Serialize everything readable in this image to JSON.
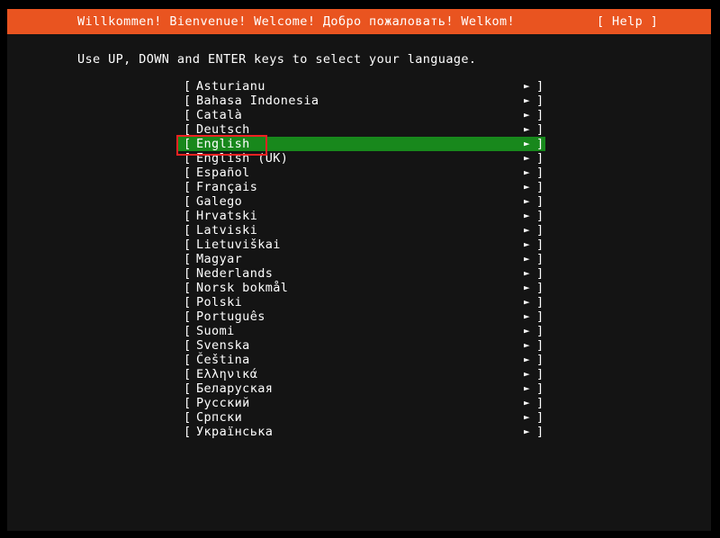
{
  "window": {
    "bezel_color": "#000000",
    "terminal_bg": "#141414"
  },
  "banner": {
    "title": "Willkommen! Bienvenue! Welcome! Добро пожаловать! Welkom!",
    "help_label": "[ Help ]",
    "bg_color": "#e95420",
    "text_color": "#ffffff"
  },
  "instruction": {
    "text": "Use UP, DOWN and ENTER keys to select your language."
  },
  "language_menu": {
    "selected_index": 4,
    "highlight_color": "#18881c",
    "bracket_open": "[",
    "bracket_close": "]",
    "submenu_arrow": "►",
    "items": [
      {
        "label": "Asturianu"
      },
      {
        "label": "Bahasa Indonesia"
      },
      {
        "label": "Català"
      },
      {
        "label": "Deutsch"
      },
      {
        "label": "English"
      },
      {
        "label": "English (UK)"
      },
      {
        "label": "Español"
      },
      {
        "label": "Français"
      },
      {
        "label": "Galego"
      },
      {
        "label": "Hrvatski"
      },
      {
        "label": "Latviski"
      },
      {
        "label": "Lietuviškai"
      },
      {
        "label": "Magyar"
      },
      {
        "label": "Nederlands"
      },
      {
        "label": "Norsk bokmål"
      },
      {
        "label": "Polski"
      },
      {
        "label": "Português"
      },
      {
        "label": "Suomi"
      },
      {
        "label": "Svenska"
      },
      {
        "label": "Čeština"
      },
      {
        "label": "Ελληνικά"
      },
      {
        "label": "Беларуская"
      },
      {
        "label": "Русский"
      },
      {
        "label": "Српски"
      },
      {
        "label": "Українська"
      }
    ]
  },
  "annotation": {
    "color": "#ee2222",
    "target": "English"
  }
}
